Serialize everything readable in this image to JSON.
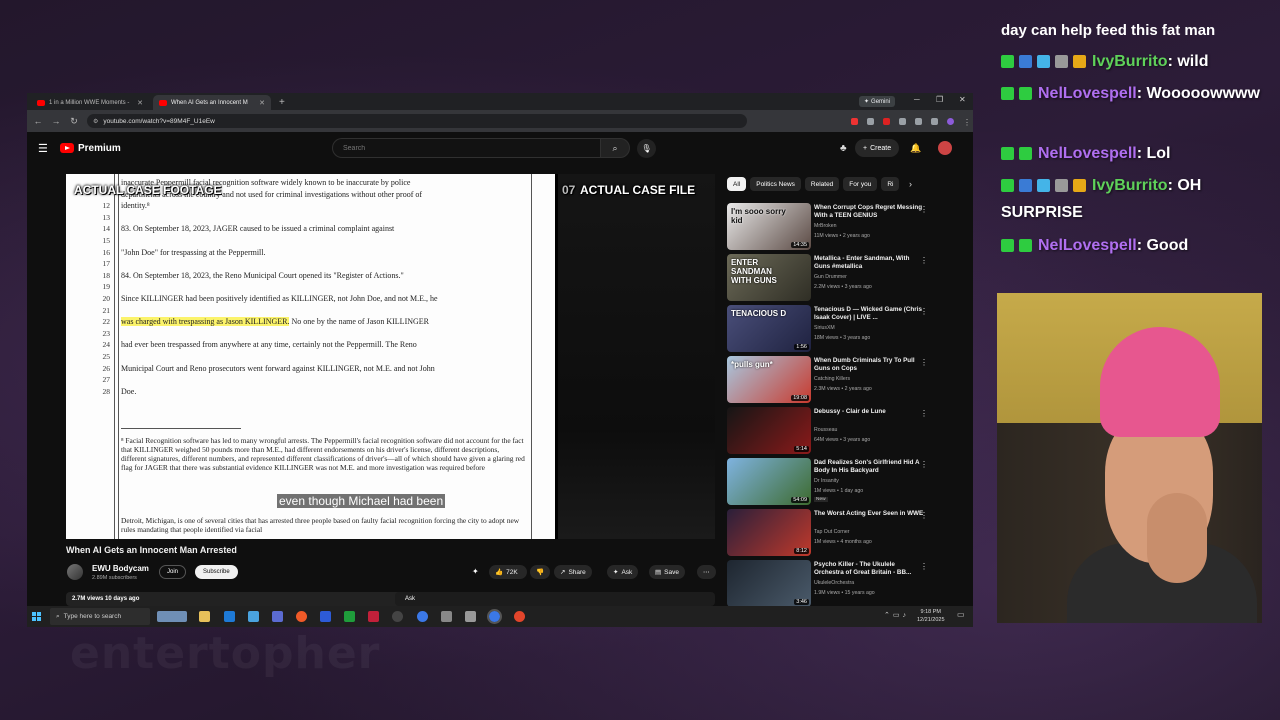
{
  "chat": {
    "top_partial": "day can help feed this fat man",
    "messages": [
      {
        "user": "IvyBurrito",
        "text": ": wild",
        "color": "green"
      },
      {
        "user": "NelLovespell",
        "text": ": Wooooowwww",
        "color": "purple"
      },
      {
        "user": "NelLovespell",
        "text": ": Lol",
        "color": "purple"
      },
      {
        "user": "IvyBurrito",
        "text": ": OH SURPRISE",
        "color": "green"
      },
      {
        "user": "NelLovespell",
        "text": ": Good",
        "color": "purple"
      }
    ]
  },
  "browser": {
    "tabs": [
      {
        "title": "1 in a Million WWE Moments -",
        "active": false
      },
      {
        "title": "When AI Gets an Innocent M",
        "active": true
      }
    ],
    "gemini_label": "Gemini",
    "url": "youtube.com/watch?v=89M4F_U1eEw"
  },
  "youtube": {
    "logo_text": "Premium",
    "search_placeholder": "Search",
    "create_label": "Create",
    "video": {
      "label_left": "ACTUAL CASE FOOTAGE",
      "label_right": "ACTUAL CASE FILE",
      "label_right_prefix": "07",
      "caption": "even though Michael had been",
      "doc": {
        "lines": [
          {
            "n": "",
            "t": "inaccurate Peppermill facial recognition software widely known to be inaccurate by police"
          },
          {
            "n": "",
            "t": "departments across the country and not used for criminal investigations without other proof of"
          },
          {
            "n": "12",
            "t": "identity.⁸"
          },
          {
            "n": "13",
            "t": ""
          },
          {
            "n": "14",
            "t": "        83.      On September 18, 2023, JAGER caused to be issued a criminal complaint against"
          },
          {
            "n": "15",
            "t": ""
          },
          {
            "n": "16",
            "t": "\"John Doe\" for trespassing at the Peppermill."
          },
          {
            "n": "17",
            "t": ""
          },
          {
            "n": "18",
            "t": "        84.      On September 18, 2023, the Reno Municipal Court opened its \"Register of Actions.\""
          },
          {
            "n": "19",
            "t": ""
          },
          {
            "n": "20",
            "t": "Since KILLINGER had been positively identified as KILLINGER, not John Doe, and not M.E., he"
          },
          {
            "n": "21",
            "t": ""
          },
          {
            "n": "22",
            "t": "was charged with trespassing as Jason KILLINGER.",
            "hl": true,
            "rest": " No one by the name of Jason KILLINGER"
          },
          {
            "n": "23",
            "t": ""
          },
          {
            "n": "24",
            "t": "had ever been trespassed from anywhere at any time, certainly not the Peppermill. The Reno"
          },
          {
            "n": "25",
            "t": ""
          },
          {
            "n": "26",
            "t": "Municipal Court and Reno prosecutors went forward against KILLINGER, not M.E. and not John"
          },
          {
            "n": "27",
            "t": ""
          },
          {
            "n": "28",
            "t": "Doe."
          }
        ],
        "footnote": "⁸ Facial Recognition software has led to many wrongful arrests. The Peppermill's facial recognition software did not account for the fact that KILLINGER weighed 50 pounds more than M.E., had different endorsements on his driver's license, different descriptions, different signatures, different numbers, and represented different classifications of driver's—all of which should have given a glaring red flag for JAGER that there was substantial evidence KILLINGER was not M.E. and more investigation was required before",
        "footnote2": "Detroit, Michigan, is one of several cities that has arrested three people based on faulty facial recognition forcing the city to adopt new rules mandating that people identified via facial"
      }
    },
    "title": "When AI Gets an Innocent Man Arrested",
    "channel": {
      "name": "EWU Bodycam",
      "subs": "2.89M subscribers",
      "join": "Join",
      "subscribe": "Subscribe"
    },
    "actions": {
      "likes": "72K",
      "share": "Share",
      "ask": "Ask",
      "save": "Save"
    },
    "views_line": "2.7M views  10 days ago",
    "ask_label": "Ask",
    "chips": [
      "All",
      "Politics News",
      "Related",
      "For you",
      "Ri"
    ],
    "recommendations": [
      {
        "title": "When Corrupt Cops Regret Messing With a TEEN GENIUS",
        "channel": "MrBroken",
        "meta": "11M views • 2 years ago",
        "duration": "14:35",
        "thumb_text": "I'm sooo sorry kid",
        "colors": [
          "#e9e9e9",
          "#5b4a44"
        ]
      },
      {
        "title": "Metallica - Enter Sandman, With Guns #metallica",
        "channel": "Gun Drummer",
        "meta": "2.2M views • 3 years ago",
        "duration": "",
        "thumb_text": "ENTER SANDMAN WITH GUNS",
        "colors": [
          "#6c6a58",
          "#2f2e25"
        ]
      },
      {
        "title": "Tenacious D — Wicked Game (Chris Isaak Cover) | LIVE ...",
        "channel": "SiriusXM",
        "meta": "18M views • 3 years ago",
        "duration": "1:56",
        "thumb_text": "TENACIOUS D",
        "colors": [
          "#4a4f7a",
          "#1f2240"
        ]
      },
      {
        "title": "When Dumb Criminals Try To Pull Guns on Cops",
        "channel": "Catching Killers",
        "meta": "2.3M views • 2 years ago",
        "duration": "19:08",
        "thumb_text": "*pulls gun*",
        "colors": [
          "#a8c8e0",
          "#c83a2e"
        ]
      },
      {
        "title": "Debussy - Clair de Lune",
        "channel": "Rousseau",
        "meta": "64M views • 3 years ago",
        "duration": "5:14",
        "thumb_text": "",
        "colors": [
          "#151515",
          "#8b1a1a"
        ]
      },
      {
        "title": "Dad Realizes Son's Girlfriend Hid A Body In His Backyard",
        "channel": "Dr Insanity",
        "meta": "1M views • 1 day ago",
        "duration": "54:09",
        "thumb_text": "",
        "colors": [
          "#7fb3e0",
          "#3d6b2f"
        ],
        "new": "New"
      },
      {
        "title": "The Worst Acting Ever Seen in WWE",
        "channel": "Tap Out Corner",
        "meta": "1M views • 4 months ago",
        "duration": "8:12",
        "thumb_text": "",
        "colors": [
          "#2a1f3a",
          "#c0392b"
        ]
      },
      {
        "title": "Psycho Killer - The Ukulele Orchestra of Great Britain - BB...",
        "channel": "UkuleleOrchestra",
        "meta": "1.9M views • 15 years ago",
        "duration": "3:46",
        "thumb_text": "",
        "colors": [
          "#1e2630",
          "#4a5a6a"
        ]
      }
    ]
  },
  "taskbar": {
    "search_placeholder": "Type here to search",
    "time": "9:18 PM",
    "date": "12/21/2025"
  },
  "background_watermark": "entertopher"
}
